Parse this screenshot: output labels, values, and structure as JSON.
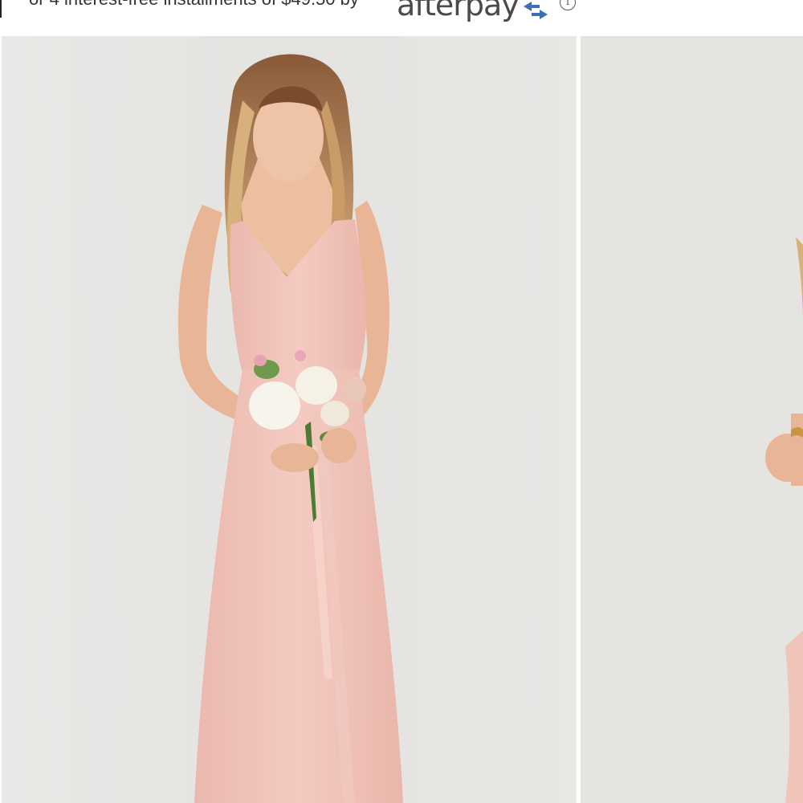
{
  "installments": {
    "text": "or 4 interest-free installments of $49.50 by",
    "provider_word": "afterpay",
    "info_icon": "info-icon",
    "brand_color": "#b2fce4"
  },
  "gallery": {
    "slides": [
      {
        "name": "product-photo-front",
        "icon": "dress-photo"
      },
      {
        "name": "product-photo-side",
        "icon": "dress-photo"
      }
    ],
    "dress_color": "#f3c6bd",
    "background_color": "#e7e6e3"
  }
}
